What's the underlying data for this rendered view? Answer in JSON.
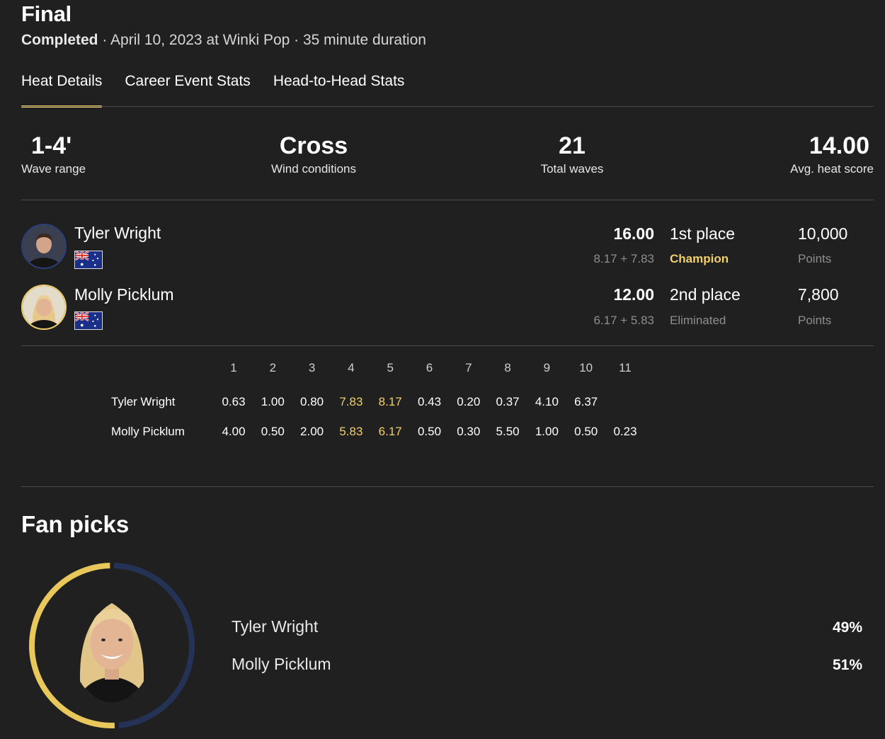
{
  "header": {
    "title": "Final",
    "status": "Completed",
    "details": " · April 10, 2023 at Winki Pop · 35 minute duration"
  },
  "tabs": [
    {
      "label": "Heat Details",
      "active": true
    },
    {
      "label": "Career Event Stats",
      "active": false
    },
    {
      "label": "Head-to-Head Stats",
      "active": false
    }
  ],
  "stats": [
    {
      "value": "1-4'",
      "label": "Wave range"
    },
    {
      "value": "Cross",
      "label": "Wind conditions"
    },
    {
      "value": "21",
      "label": "Total waves"
    },
    {
      "value": "14.00",
      "label": "Avg. heat score"
    }
  ],
  "surfers": [
    {
      "name": "Tyler Wright",
      "total": "16.00",
      "breakdown": "8.17 + 7.83",
      "place": "1st place",
      "result": "Champion",
      "points": "10,000",
      "points_label": "Points"
    },
    {
      "name": "Molly Picklum",
      "total": "12.00",
      "breakdown": "6.17 + 5.83",
      "place": "2nd place",
      "result": "Eliminated",
      "points": "7,800",
      "points_label": "Points"
    }
  ],
  "waves": {
    "numbers": [
      "1",
      "2",
      "3",
      "4",
      "5",
      "6",
      "7",
      "8",
      "9",
      "10",
      "11"
    ],
    "rows": [
      {
        "name": "Tyler Wright",
        "scores": [
          "0.63",
          "1.00",
          "0.80",
          "7.83",
          "8.17",
          "0.43",
          "0.20",
          "0.37",
          "4.10",
          "6.37",
          ""
        ],
        "highlight": [
          3,
          4
        ]
      },
      {
        "name": "Molly Picklum",
        "scores": [
          "4.00",
          "0.50",
          "2.00",
          "5.83",
          "6.17",
          "0.50",
          "0.30",
          "5.50",
          "1.00",
          "0.50",
          "0.23"
        ],
        "highlight": [
          3,
          4
        ]
      }
    ]
  },
  "fan_picks": {
    "title": "Fan picks",
    "picks": [
      {
        "name": "Tyler Wright",
        "percent": "49%",
        "share": 49,
        "color": "#243255"
      },
      {
        "name": "Molly Picklum",
        "percent": "51%",
        "share": 51,
        "color": "#e8c85a"
      }
    ]
  },
  "colors": {
    "background": "#202020",
    "accent": "#f1cf6a",
    "muted": "#8e8e8e"
  }
}
